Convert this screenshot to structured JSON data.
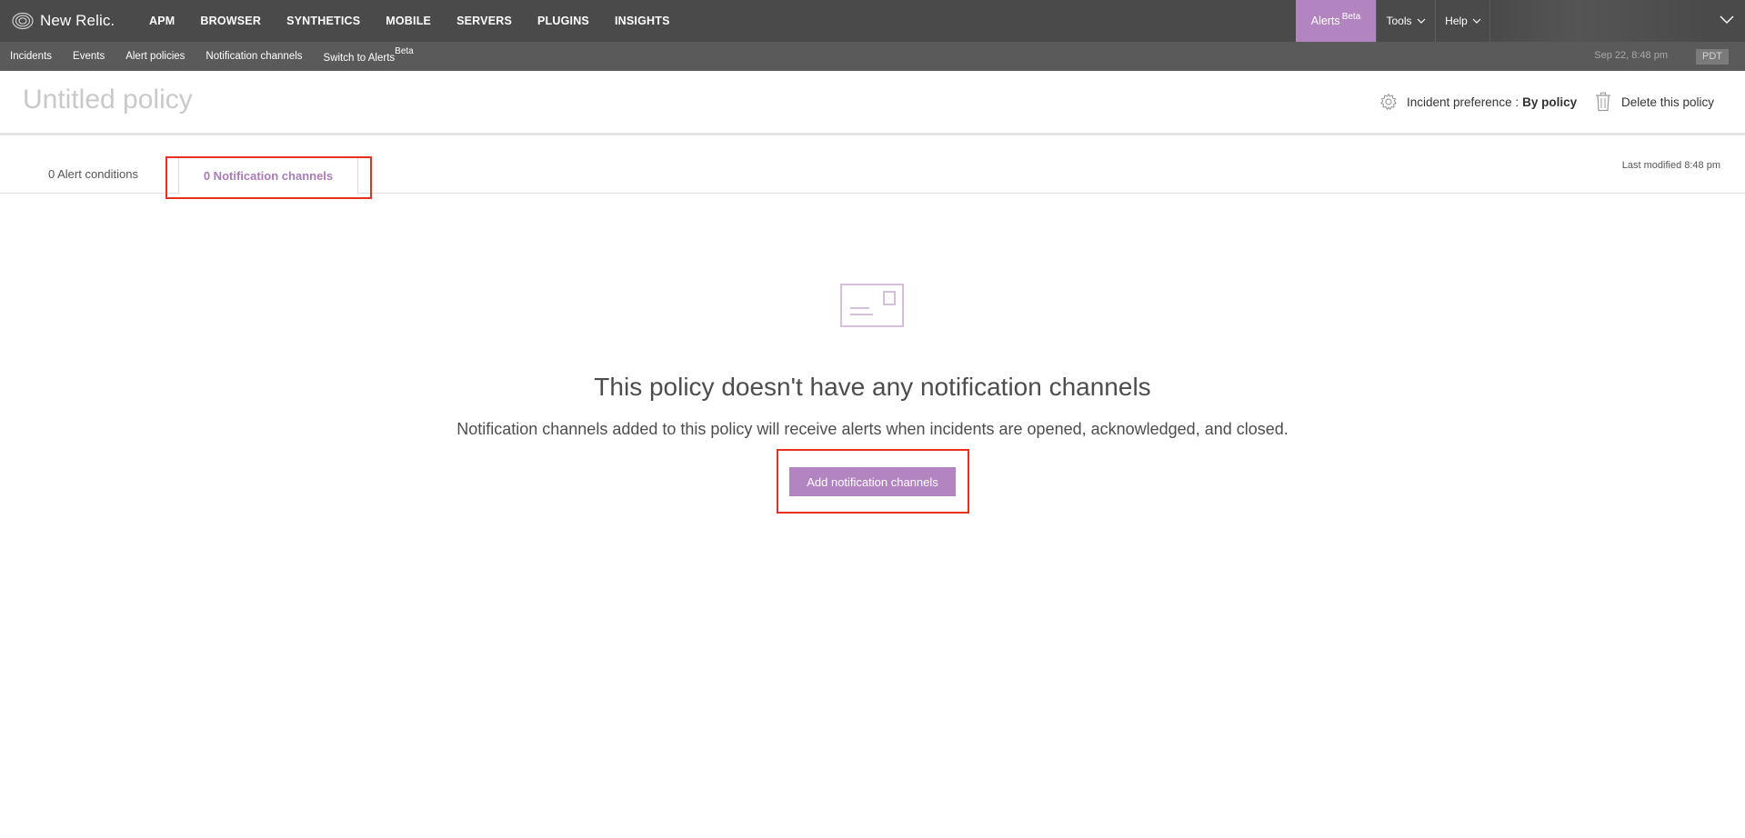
{
  "header": {
    "logo_text": "New Relic.",
    "nav": [
      "APM",
      "BROWSER",
      "SYNTHETICS",
      "MOBILE",
      "SERVERS",
      "PLUGINS",
      "INSIGHTS"
    ],
    "alerts_label": "Alerts",
    "alerts_badge": "Beta",
    "tools_label": "Tools",
    "help_label": "Help"
  },
  "subnav": {
    "items": [
      "Incidents",
      "Events",
      "Alert policies",
      "Notification channels"
    ],
    "switch_label": "Switch to Alerts",
    "switch_badge": "Beta",
    "timestamp": "Sep 22, 8:48 pm",
    "timezone": "PDT"
  },
  "policy": {
    "title": "Untitled policy",
    "incident_pref_label": "Incident preference :",
    "incident_pref_value": "By policy",
    "delete_label": "Delete this policy"
  },
  "tabs": {
    "conditions": "0 Alert conditions",
    "channels": "0 Notification channels",
    "last_modified": "Last modified 8:48 pm"
  },
  "empty_state": {
    "title": "This policy doesn't have any notification channels",
    "description": "Notification channels added to this policy will receive alerts when incidents are opened, acknowledged, and closed.",
    "button_label": "Add notification channels"
  },
  "colors": {
    "accent": "#b284c0",
    "topbar": "#4a4a4a",
    "subbar": "#5a5a5a",
    "highlight": "#e8301c"
  },
  "icons": {
    "logo": "new-relic-logo-icon",
    "settings": "gear-icon",
    "delete": "trash-icon",
    "envelope": "envelope-icon",
    "dropdown": "chevron-down-icon"
  }
}
